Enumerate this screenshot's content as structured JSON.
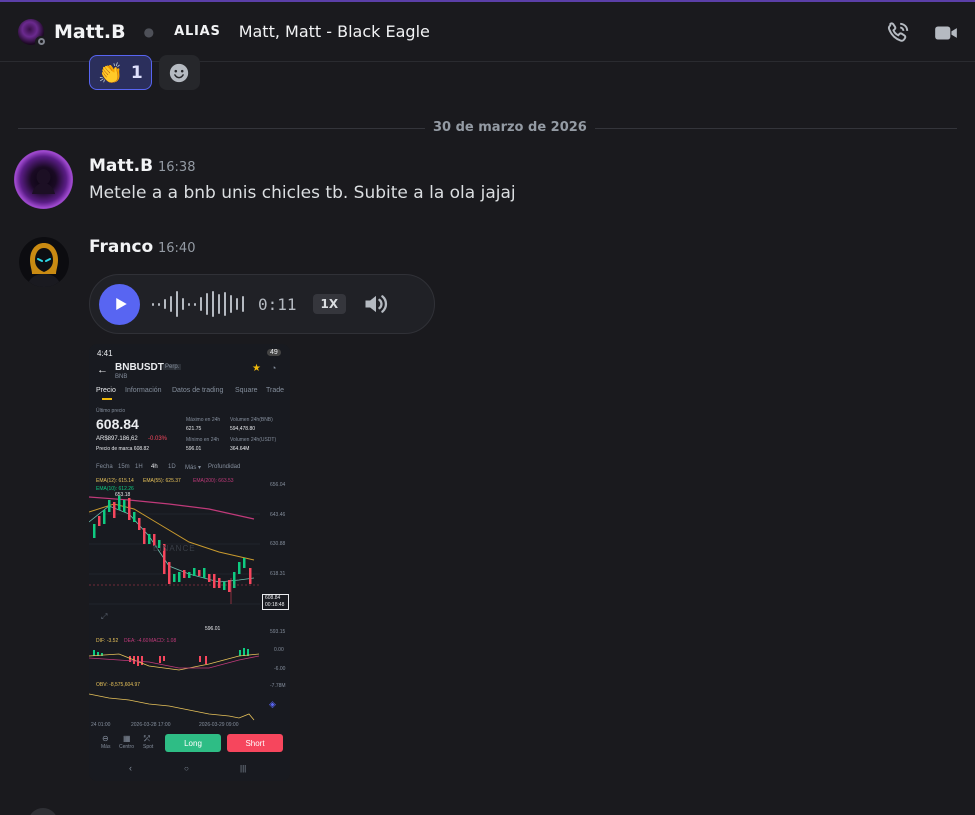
{
  "header": {
    "name": "Matt.B",
    "alias_label": "ALIAS",
    "alias_value": "Matt, Matt - Black Eagle"
  },
  "reactions": [
    {
      "emoji": "👏",
      "count": "1"
    }
  ],
  "date_divider": "30 de marzo de 2026",
  "messages": [
    {
      "author": "Matt.B",
      "time": "16:38",
      "text": "Metele a a bnb unis chicles tb. Subite a la ola jajaj"
    },
    {
      "author": "Franco",
      "time": "16:40",
      "voice": {
        "duration": "0:11",
        "speed": "1X"
      }
    }
  ],
  "screenshot": {
    "status_time": "4:41",
    "battery": "49",
    "pair": "BNBUSDT",
    "perp": "Perp.",
    "base": "BNB",
    "tabs": [
      "Precio",
      "Información",
      "Datos de trading",
      "Square",
      "Trade"
    ],
    "last_price_label": "Último precio",
    "last_price": "608.84",
    "ars_price": "AR$897.186,62",
    "change": "-0.03%",
    "mark_price": "Precio de marca 608.82",
    "stats": {
      "high_label": "Máximo en 24h",
      "high": "621.75",
      "low_label": "Mínimo en 24h",
      "low": "596.01",
      "vol_bnb_label": "Volumen 24h(BNB)",
      "vol_bnb": "594,478.80",
      "vol_usdt_label": "Volumen 24h(USDT)",
      "vol_usdt": "364.64M"
    },
    "timeframes": [
      "Fecha",
      "15m",
      "1H",
      "4h",
      "1D",
      "Más ▾",
      "Profundidad"
    ],
    "ema_line1": [
      "EMA(12): 615.14",
      "EMA(55): 625.37",
      "EMA(200): 663.53"
    ],
    "ema_line2": "EMA(10): 612.26",
    "high_mark": "653.18",
    "low_mark": "596.01",
    "watermark": "BINANCE",
    "y_ticks": [
      "656.04",
      "643.46",
      "630.88",
      "618.31",
      "593.15"
    ],
    "price_tag": "608.84",
    "countdown": "00:18:48",
    "macd_labels": [
      "DIF: -3.52",
      "DEA: -4.60",
      "MACD: 1.08"
    ],
    "macd_ticks": [
      "0.00",
      "-6.00"
    ],
    "obv_label": "OBV: -8,575,604.97",
    "obv_tick": "-7.78M",
    "x_ticks": [
      "24 01:00",
      "2026-03-28 17:00",
      "2026-03-29 09:00"
    ],
    "actions": [
      "Más",
      "Centro",
      "Spot"
    ],
    "long_label": "Long",
    "short_label": "Short"
  }
}
